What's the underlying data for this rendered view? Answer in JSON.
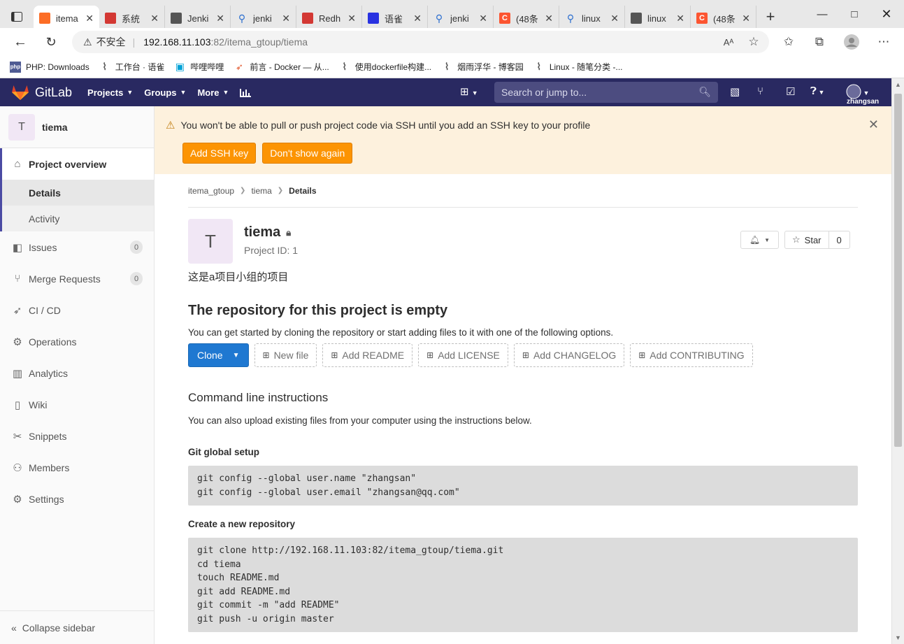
{
  "browser": {
    "tabs": [
      {
        "title": "itema",
        "active": true,
        "icon": "gitlab-icon",
        "color": "#fc6d26"
      },
      {
        "title": "系统",
        "active": false,
        "icon": "jenkins-icon",
        "color": "#d33833"
      },
      {
        "title": "Jenki",
        "active": false,
        "icon": "yuque-icon",
        "color": "#555555"
      },
      {
        "title": "jenki",
        "active": false,
        "icon": "search-icon",
        "color": "#2b6ecf"
      },
      {
        "title": "Redh",
        "active": false,
        "icon": "jenkins-icon",
        "color": "#d33833"
      },
      {
        "title": "语雀",
        "active": false,
        "icon": "baidu-icon",
        "color": "#2932e1"
      },
      {
        "title": "jenki",
        "active": false,
        "icon": "search-icon",
        "color": "#2b6ecf"
      },
      {
        "title": "(48条",
        "active": false,
        "icon": "csdn-icon",
        "color": "#fc5531"
      },
      {
        "title": "linux",
        "active": false,
        "icon": "search-icon",
        "color": "#2b6ecf"
      },
      {
        "title": "linux",
        "active": false,
        "icon": "yuque-icon",
        "color": "#555555"
      },
      {
        "title": "(48条",
        "active": false,
        "icon": "csdn-icon",
        "color": "#fc5531"
      }
    ],
    "insecure_label": "不安全",
    "url_host": "192.168.11.103",
    "url_rest": ":82/itema_gtoup/tiema",
    "bookmarks": [
      {
        "label": "PHP: Downloads",
        "icon": "php-icon"
      },
      {
        "label": "工作台 · 语雀",
        "icon": "yuque-icon"
      },
      {
        "label": "哔哩哔哩",
        "icon": "bilibili-icon"
      },
      {
        "label": "前言 - Docker — 从...",
        "icon": "rocket-icon"
      },
      {
        "label": "使用dockerfile构建...",
        "icon": "yuque-icon"
      },
      {
        "label": "烟雨浮华 - 博客园",
        "icon": "yuque-icon"
      },
      {
        "label": "Linux - 随笔分类 -...",
        "icon": "yuque-icon"
      }
    ]
  },
  "header": {
    "brand": "GitLab",
    "nav": [
      "Projects",
      "Groups",
      "More"
    ],
    "search_placeholder": "Search or jump to...",
    "username": "zhangsan",
    "accent": "#292961"
  },
  "sidebar": {
    "avatar_letter": "T",
    "project_name": "tiema",
    "overview_label": "Project overview",
    "overview_sub": [
      "Details",
      "Activity"
    ],
    "items": [
      {
        "label": "Issues",
        "icon": "issues-icon",
        "badge": "0"
      },
      {
        "label": "Merge Requests",
        "icon": "merge-request-icon",
        "badge": "0"
      },
      {
        "label": "CI / CD",
        "icon": "rocket-icon"
      },
      {
        "label": "Operations",
        "icon": "cloud-gear-icon"
      },
      {
        "label": "Analytics",
        "icon": "chart-icon"
      },
      {
        "label": "Wiki",
        "icon": "book-icon"
      },
      {
        "label": "Snippets",
        "icon": "scissors-icon"
      },
      {
        "label": "Members",
        "icon": "users-icon"
      },
      {
        "label": "Settings",
        "icon": "gear-icon"
      }
    ],
    "collapse_label": "Collapse sidebar"
  },
  "alert": {
    "message": "You won't be able to pull or push project code via SSH until you add an SSH key to your profile",
    "add_ssh_label": "Add SSH key",
    "dismiss_label": "Don't show again"
  },
  "breadcrumb": [
    "itema_gtoup",
    "tiema",
    "Details"
  ],
  "project": {
    "avatar_letter": "T",
    "name": "tiema",
    "id_label": "Project ID: 1",
    "description": "这是a项目小组的项目",
    "star_label": "Star",
    "star_count": "0"
  },
  "empty_repo": {
    "title": "The repository for this project is empty",
    "text": "You can get started by cloning the repository or start adding files to it with one of the following options.",
    "clone_label": "Clone",
    "buttons": [
      "New file",
      "Add README",
      "Add LICENSE",
      "Add CHANGELOG",
      "Add CONTRIBUTING"
    ]
  },
  "cli": {
    "title": "Command line instructions",
    "text": "You can also upload existing files from your computer using the instructions below.",
    "global_setup_title": "Git global setup",
    "global_setup_code": "git config --global user.name \"zhangsan\"\ngit config --global user.email \"zhangsan@qq.com\"",
    "new_repo_title": "Create a new repository",
    "new_repo_code": "git clone http://192.168.11.103:82/itema_gtoup/tiema.git\ncd tiema\ntouch README.md\ngit add README.md\ngit commit -m \"add README\"\ngit push -u origin master"
  }
}
